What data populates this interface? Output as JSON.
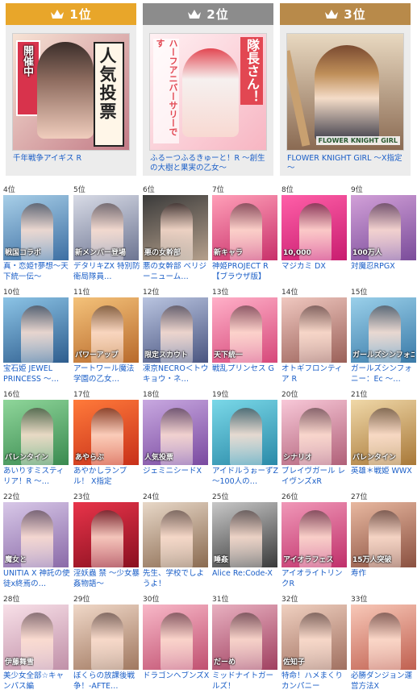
{
  "top3": [
    {
      "rank": "1位",
      "color": "#e8a62a",
      "title": "千年戦争アイギス R",
      "img_text": "人気投票",
      "img_sub": "開催中",
      "bg1": "#f3d9c8",
      "bg2": "#b86d7a"
    },
    {
      "rank": "2位",
      "color": "#8c8c8c",
      "title": "ふるーつふるきゅーと！R ～創生の大樹と果実の乙女～",
      "img_text": "隊長さん！",
      "img_sub": "ハーフアニバーサリーです",
      "bg1": "#fde7ea",
      "bg2": "#e36b7c"
    },
    {
      "rank": "3位",
      "color": "#b88a4a",
      "title": "FLOWER KNIGHT GIRL ～X指定～",
      "img_text": "FLOWER KNIGHT GIRL",
      "img_sub": "",
      "bg1": "#d9c3a7",
      "bg2": "#6c4b3a"
    }
  ],
  "ranks": [
    {
      "rank": "4位",
      "title": "真・恋姫†夢想～天下統一伝～",
      "tag": "戦国コラボ",
      "c1": "#a8cfe8",
      "c2": "#3d6fa3"
    },
    {
      "rank": "5位",
      "title": "デタリキZX 特別防衛局隊員…",
      "tag": "新メンバー登場",
      "c1": "#d8dbe6",
      "c2": "#6d7592"
    },
    {
      "rank": "6位",
      "title": "悪の女幹部 ベリジーニューム…",
      "tag": "悪の女幹部",
      "c1": "#3a3a3a",
      "c2": "#b5a08c"
    },
    {
      "rank": "7位",
      "title": "神姫PROJECT R【ブラウザ版】",
      "tag": "新キャラ",
      "c1": "#ff9fb8",
      "c2": "#c8306a"
    },
    {
      "rank": "8位",
      "title": "マジカミ DX",
      "tag": "10,000",
      "c1": "#ff5fa8",
      "c2": "#c81d6f"
    },
    {
      "rank": "9位",
      "title": "対魔忍RPGX",
      "tag": "100万人",
      "c1": "#d2a0d8",
      "c2": "#7a4c9a"
    },
    {
      "rank": "10位",
      "title": "宝石姫 JEWEL PRINCESS ～…",
      "tag": "",
      "c1": "#8cc4e6",
      "c2": "#2e5d8e"
    },
    {
      "rank": "11位",
      "title": "アートワール魔法学園の乙女…",
      "tag": "パワーアップ",
      "c1": "#f4c27a",
      "c2": "#b86a2c"
    },
    {
      "rank": "12位",
      "title": "凍京NECRO＜トウキョウ・ネ…",
      "tag": "限定スカウト",
      "c1": "#b9c4e0",
      "c2": "#4a5580"
    },
    {
      "rank": "13位",
      "title": "戦乱プリンセス G",
      "tag": "天下統一",
      "c1": "#ffb0c8",
      "c2": "#d6487a"
    },
    {
      "rank": "14位",
      "title": "オトギフロンティア R",
      "tag": "",
      "c1": "#f0c8c0",
      "c2": "#9a6058"
    },
    {
      "rank": "15位",
      "title": "ガールズシンフォニー：Ec ～…",
      "tag": "ガールズシンフォニー",
      "c1": "#9ad0ea",
      "c2": "#3a7aa8"
    },
    {
      "rank": "16位",
      "title": "あいりすミスティリア！R ～…",
      "tag": "バレンタイン",
      "c1": "#8fd69a",
      "c2": "#3a8a50"
    },
    {
      "rank": "17位",
      "title": "あやかしランブル！ X指定",
      "tag": "あやらぶ",
      "c1": "#ff7a3a",
      "c2": "#c8301a"
    },
    {
      "rank": "18位",
      "title": "ジェミニシードX",
      "tag": "人気投票",
      "c1": "#c8a8e0",
      "c2": "#7a4aa0"
    },
    {
      "rank": "19位",
      "title": "アイドルうぉーずZ～100人の…",
      "tag": "",
      "c1": "#7ad8e8",
      "c2": "#2a8aa8"
    },
    {
      "rank": "20位",
      "title": "ブレイヴガール レイヴンズxR",
      "tag": "シナリオ",
      "c1": "#f8c8d8",
      "c2": "#b06078"
    },
    {
      "rank": "21位",
      "title": "英雄＊戦姫 WWX",
      "tag": "バレンタイン",
      "c1": "#f0d8a8",
      "c2": "#a87838"
    },
    {
      "rank": "22位",
      "title": "UNITIA X 神託の使徒x終焉の…",
      "tag": "魔女と",
      "c1": "#d8c8e8",
      "c2": "#8a6aa8"
    },
    {
      "rank": "23位",
      "title": "淫妖蟲 禁 ～少女暴姦物語～",
      "tag": "",
      "c1": "#e8344a",
      "c2": "#8a1020"
    },
    {
      "rank": "24位",
      "title": "先生、学校でしようよ！",
      "tag": "",
      "c1": "#e8d8c8",
      "c2": "#8a6a50"
    },
    {
      "rank": "25位",
      "title": "Alice Re:Code-X",
      "tag": "睡姦",
      "c1": "#c8c8c8",
      "c2": "#3a3a3a"
    },
    {
      "rank": "26位",
      "title": "アイオライトリンクR",
      "tag": "アイオラフェス",
      "c1": "#f098b8",
      "c2": "#c0306a"
    },
    {
      "rank": "27位",
      "title": "寿作",
      "tag": "15万人突破",
      "c1": "#e8b8a0",
      "c2": "#8a5040"
    },
    {
      "rank": "28位",
      "title": "美少女全部☆キャンパス編",
      "tag": "伊藤舞雪",
      "c1": "#f8e0e8",
      "c2": "#c090a8"
    },
    {
      "rank": "29位",
      "title": "ぼくらの放課後戦争！-AFTE…",
      "tag": "",
      "c1": "#f0d8c8",
      "c2": "#a07860"
    },
    {
      "rank": "30位",
      "title": "ドラゴンヘブンズX",
      "tag": "",
      "c1": "#f8b8c8",
      "c2": "#c05070"
    },
    {
      "rank": "31位",
      "title": "ミッドナイトガールズ！",
      "tag": "だーめ",
      "c1": "#e8b0c0",
      "c2": "#a04060"
    },
    {
      "rank": "32位",
      "title": "特命！ハメまくりカンパニー",
      "tag": "佐知子",
      "c1": "#f0d0c0",
      "c2": "#a07060"
    },
    {
      "rank": "33位",
      "title": "必勝ダンジョン運営方法X",
      "tag": "",
      "c1": "#f8c8b8",
      "c2": "#c06050"
    }
  ]
}
